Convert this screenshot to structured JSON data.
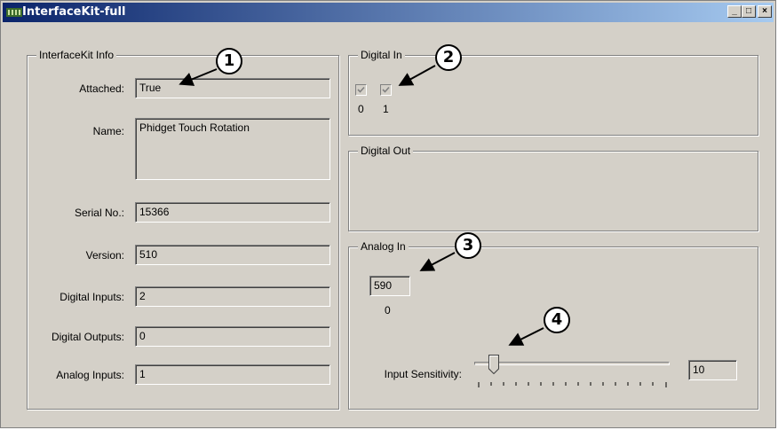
{
  "window": {
    "title": "InterfaceKit-full",
    "controls": {
      "minimize": "_",
      "maximize": "□",
      "close": "×"
    }
  },
  "info": {
    "legend": "InterfaceKit Info",
    "attached_label": "Attached:",
    "attached_value": "True",
    "name_label": "Name:",
    "name_value": "Phidget Touch Rotation",
    "serial_label": "Serial No.:",
    "serial_value": "15366",
    "version_label": "Version:",
    "version_value": "510",
    "digital_inputs_label": "Digital Inputs:",
    "digital_inputs_value": "2",
    "digital_outputs_label": "Digital Outputs:",
    "digital_outputs_value": "0",
    "analog_inputs_label": "Analog Inputs:",
    "analog_inputs_value": "1"
  },
  "digital_in": {
    "legend": "Digital In",
    "inputs": [
      {
        "index": "0",
        "checked": true
      },
      {
        "index": "1",
        "checked": true
      }
    ]
  },
  "digital_out": {
    "legend": "Digital Out"
  },
  "analog_in": {
    "legend": "Analog In",
    "value": "590",
    "index": "0",
    "sensitivity_label": "Input Sensitivity:",
    "sensitivity_value": "10",
    "sensitivity_fraction": 0.05
  },
  "callouts": [
    "1",
    "2",
    "3",
    "4"
  ]
}
